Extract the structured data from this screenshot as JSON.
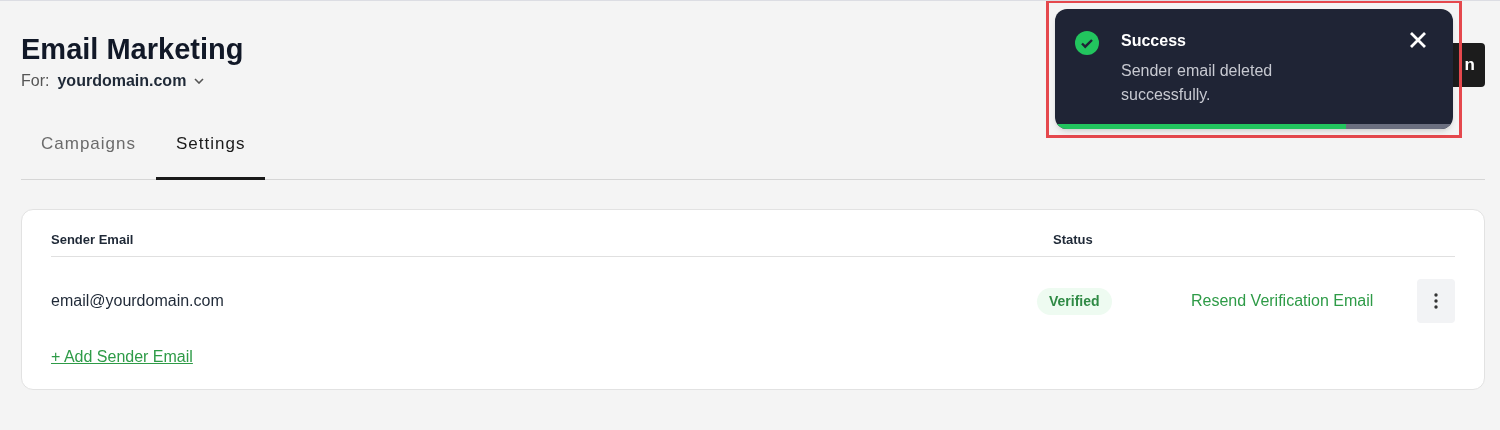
{
  "header": {
    "title": "Email Marketing",
    "for_label": "For:",
    "domain": "yourdomain.com",
    "action_button": "n"
  },
  "tabs": [
    {
      "label": "Campaigns",
      "selected": false
    },
    {
      "label": "Settings",
      "selected": true
    }
  ],
  "table": {
    "columns": [
      "Sender Email",
      "Status"
    ],
    "rows": [
      {
        "email": "email@yourdomain.com",
        "status": "Verified",
        "action": "Resend Verification Email"
      }
    ],
    "add_link": "+ Add Sender Email"
  },
  "toast": {
    "title": "Success",
    "message": "Sender email deleted successfully.",
    "level": 0.73,
    "highlighted": true
  }
}
